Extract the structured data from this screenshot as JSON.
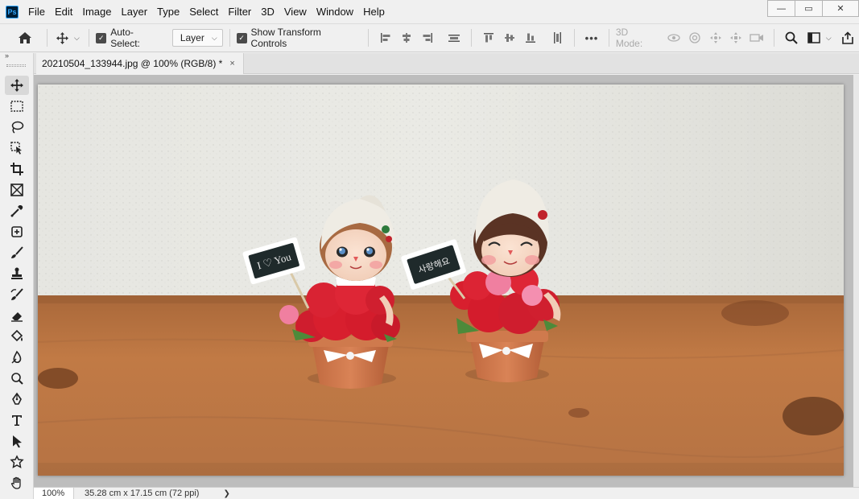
{
  "app": {
    "logo_text": "Ps",
    "menu": [
      "File",
      "Edit",
      "Image",
      "Layer",
      "Type",
      "Select",
      "Filter",
      "3D",
      "View",
      "Window",
      "Help"
    ]
  },
  "window_controls": {
    "minimize": "—",
    "restore": "▭",
    "close": "✕"
  },
  "options": {
    "auto_select_label": "Auto-Select:",
    "auto_select_checked": true,
    "layer_dropdown_value": "Layer",
    "show_transform_label": "Show Transform Controls",
    "show_transform_checked": true,
    "more_label": "•••",
    "mode_3d_label": "3D Mode:"
  },
  "document": {
    "tab_title": "20210504_133944.jpg @ 100% (RGB/8) *",
    "tab_close": "×"
  },
  "status": {
    "zoom": "100%",
    "doc_info": "35.28 cm x 17.15 cm (72 ppi)",
    "arrow": "❯"
  },
  "photo": {
    "sign_left": "I ♡ You",
    "sign_right": "사랑해요"
  },
  "colors": {
    "accent": "#31a8ff",
    "wall": "#e4e4df",
    "shelf": "#b8713c",
    "flower": "#d81f2e"
  }
}
